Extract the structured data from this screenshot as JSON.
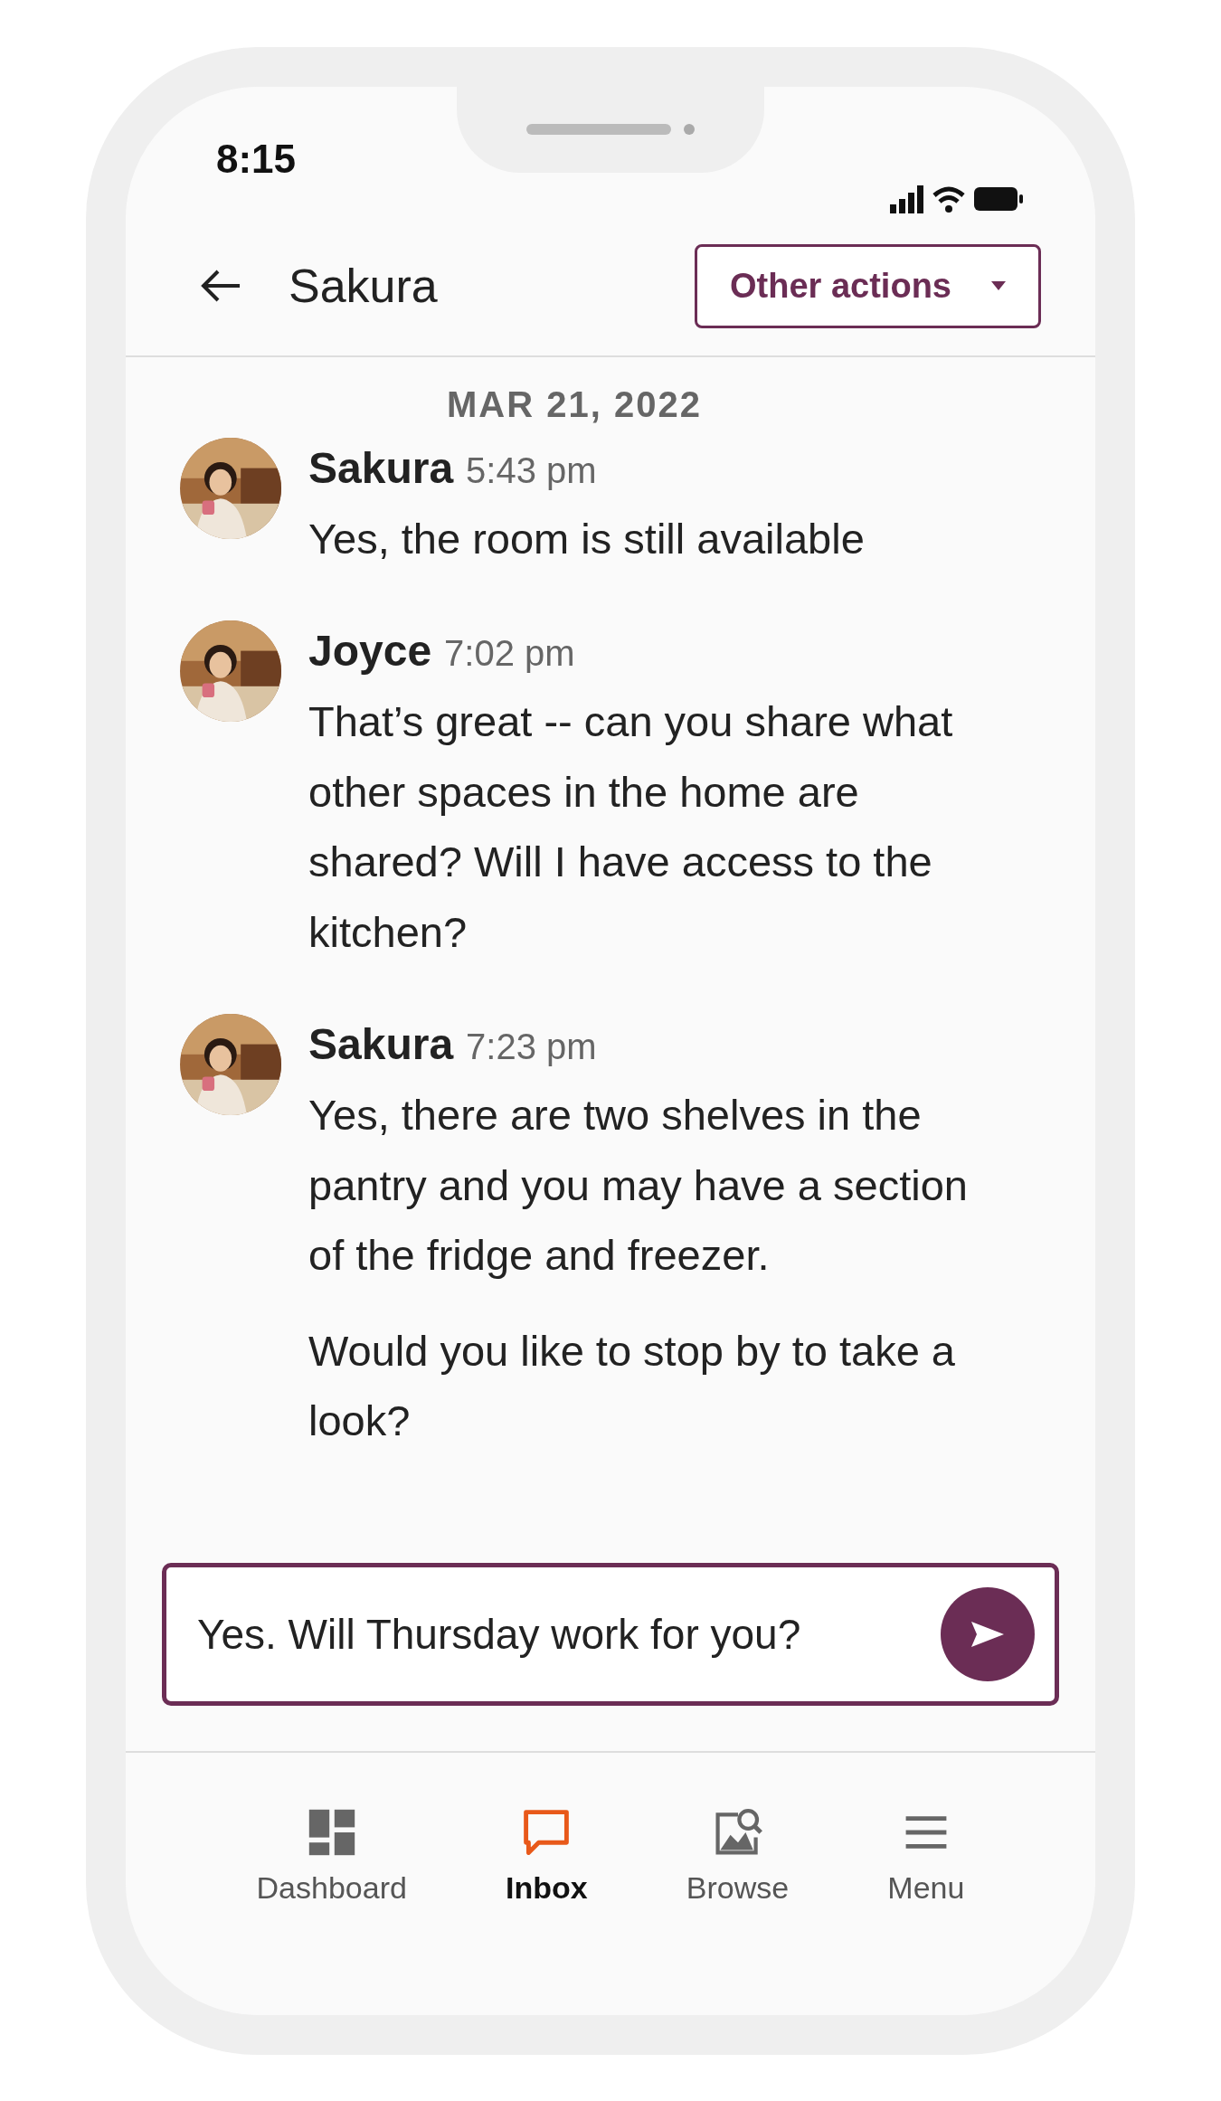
{
  "status_bar": {
    "time": "8:15"
  },
  "header": {
    "title": "Sakura",
    "actions_button": "Other actions"
  },
  "date": "MAR 21, 2022",
  "messages": [
    {
      "sender": "Sakura",
      "time": "5:43 pm",
      "avatar": {
        "kind": "picture"
      },
      "paragraphs": [
        "Yes, the room is still available"
      ]
    },
    {
      "sender": "Joyce",
      "time": "7:02 pm",
      "avatar": {
        "kind": "picture"
      },
      "paragraphs": [
        "That’s great -- can you share what other spaces in the home are shared? Will I have access to the kitchen?"
      ]
    },
    {
      "sender": "Sakura",
      "time": "7:23 pm",
      "avatar": {
        "kind": "picture"
      },
      "paragraphs": [
        "Yes, there are two shelves in the pantry and you may have a section of the fridge and freezer.",
        "Would you like to stop by to take a look?"
      ]
    }
  ],
  "composer": {
    "value": "Yes. Will Thursday work for you?"
  },
  "nav": [
    {
      "label": "Dashboard",
      "kind": "dashboard",
      "selected": false
    },
    {
      "label": "Inbox",
      "kind": "inbox",
      "selected": true
    },
    {
      "label": "Browse",
      "kind": "browse",
      "selected": false
    },
    {
      "label": "Menu",
      "kind": "menu",
      "selected": false
    }
  ]
}
